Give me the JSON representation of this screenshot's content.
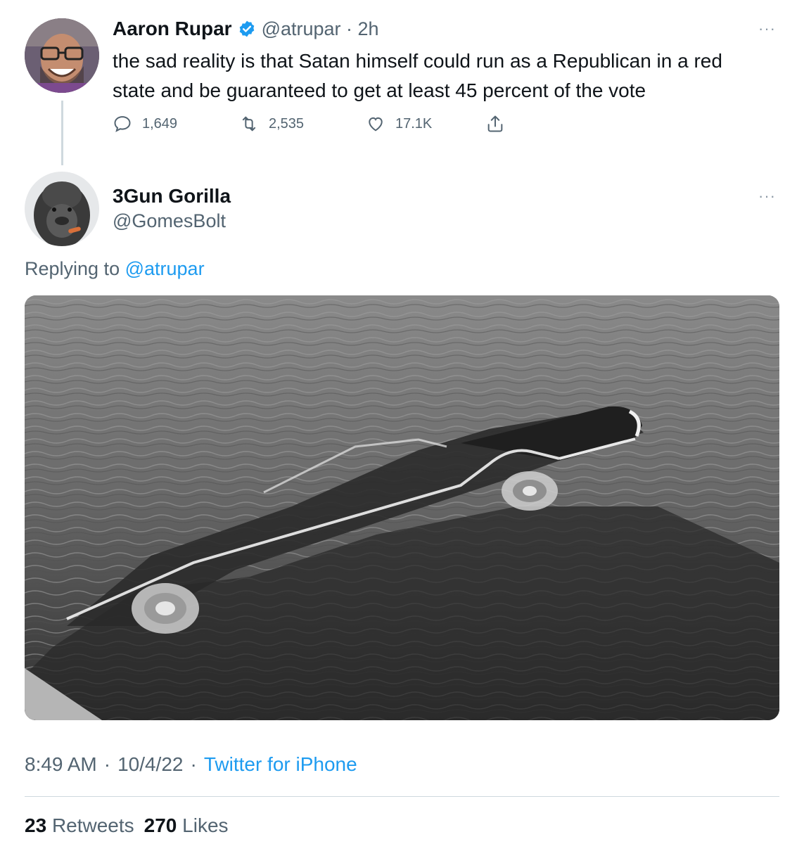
{
  "parent_tweet": {
    "author_name": "Aaron Rupar",
    "handle_time": "@atrupar · 2h",
    "text_line1": "the sad reality is that Satan himself could run as a Republican in a red",
    "text_line2": "state and be guaranteed to get at least 45 percent of the vote",
    "replies": "1,649",
    "retweets": "2,535",
    "likes": "17.1K",
    "more_label": "···"
  },
  "reply_tweet": {
    "author_name": "3Gun Gorilla",
    "handle": "@GomesBolt",
    "more_label": "···",
    "replying_prefix": "Replying to",
    "replying_handle": "@atrupar",
    "time": "8:49 AM",
    "date": "10/4/22",
    "source": "Twitter for iPhone",
    "separator": "·",
    "retweets_count": "23",
    "retweets_label": "Retweets",
    "likes_count": "270",
    "likes_label": "Likes"
  },
  "icons": {
    "reply": "reply-icon",
    "retweet": "retweet-icon",
    "like": "heart-icon",
    "share": "share-icon",
    "verified": "verified-badge-icon"
  },
  "colors": {
    "link": "#1d9bf0",
    "muted": "#536471",
    "verified": "#1d9bf0"
  }
}
